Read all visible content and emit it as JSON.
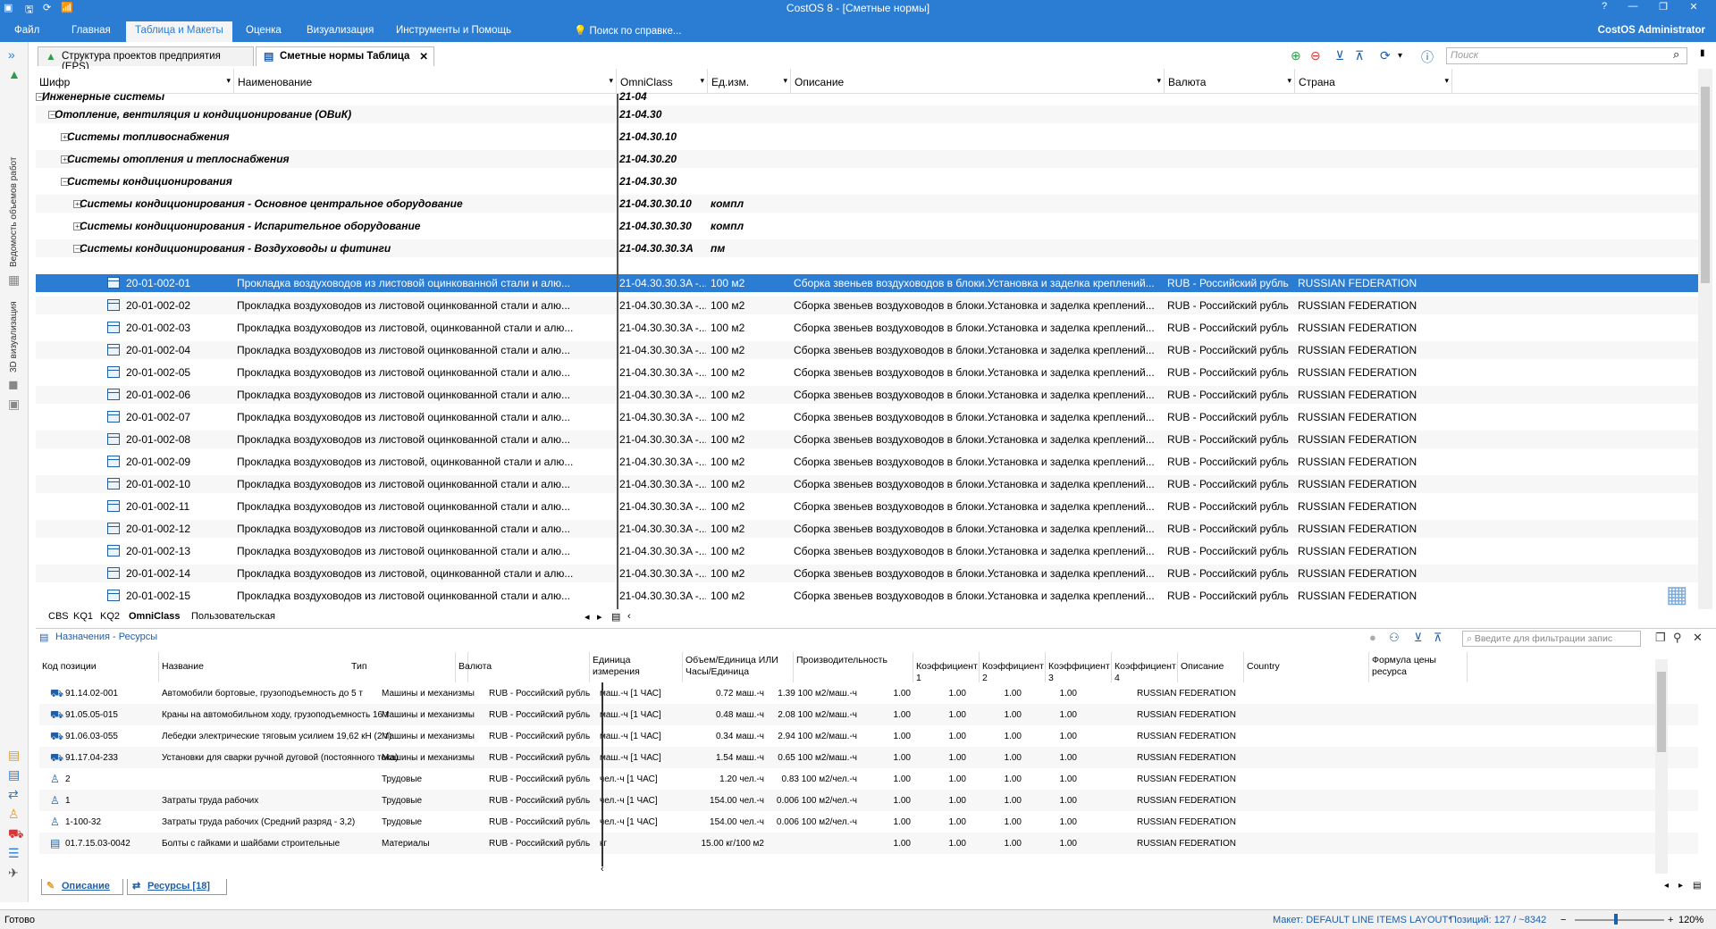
{
  "app": {
    "title": "CostOS 8 - [Сметные нормы]",
    "user": "CostOS Administrator",
    "help_search": "Поиск по справке..."
  },
  "menu": [
    "Файл",
    "Главная",
    "Таблица и Макеты",
    "Оценка",
    "Визуализация",
    "Инструменты и Помощь"
  ],
  "left_vertical": [
    "Ведомость объемов работ",
    "3D визуализация"
  ],
  "doc_tabs": [
    "Структура проектов предприятия (EPS)",
    "Сметные нормы Таблица"
  ],
  "quick_search_placeholder": "Поиск",
  "columns": [
    "Шифр",
    "Наименование",
    "OmniClass",
    "Ед.изм.",
    "Описание",
    "Валюта",
    "Страна"
  ],
  "groups": [
    {
      "name": "Инженерные системы",
      "omni": "21-04",
      "unit": "",
      "exp": "−"
    },
    {
      "name": "Отопление, вентиляция и кондиционирование (ОВиК)",
      "omni": "21-04.30",
      "unit": "",
      "exp": "−"
    },
    {
      "name": "Системы топливоснабжения",
      "omni": "21-04.30.10",
      "unit": "",
      "exp": "+"
    },
    {
      "name": "Системы отопления и теплоснабжения",
      "omni": "21-04.30.20",
      "unit": "",
      "exp": "+"
    },
    {
      "name": "Системы кондиционирования",
      "omni": "21-04.30.30",
      "unit": "",
      "exp": "−"
    },
    {
      "name": "Системы кондиционирования - Основное центральное оборудование",
      "omni": "21-04.30.30.10",
      "unit": "компл",
      "exp": "+"
    },
    {
      "name": "Системы кондиционирования - Испарительное оборудование",
      "omni": "21-04.30.30.30",
      "unit": "компл",
      "exp": "+"
    },
    {
      "name": "Системы кондиционирования - Воздуховоды и фитинги",
      "omni": "21-04.30.30.3A",
      "unit": "пм",
      "exp": "−"
    }
  ],
  "items": [
    {
      "code": "20-01-002-01",
      "name": "Прокладка воздуховодов из листовой оцинкованной стали и алю...",
      "omni": "21-04.30.30.3A -...",
      "unit": "100 м2",
      "desc": "Сборка звеньев воздуховодов в блоки.Установка и заделка креплений...",
      "cur": "RUB - Российский рубль",
      "country": "RUSSIAN FEDERATION"
    },
    {
      "code": "20-01-002-02",
      "name": "Прокладка воздуховодов из листовой оцинкованной стали и алю...",
      "omni": "21-04.30.30.3A -...",
      "unit": "100 м2",
      "desc": "Сборка звеньев воздуховодов в блоки.Установка и заделка креплений...",
      "cur": "RUB - Российский рубль",
      "country": "RUSSIAN FEDERATION"
    },
    {
      "code": "20-01-002-03",
      "name": "Прокладка воздуховодов из листовой, оцинкованной стали и алю...",
      "omni": "21-04.30.30.3A -...",
      "unit": "100 м2",
      "desc": "Сборка звеньев воздуховодов в блоки.Установка и заделка креплений...",
      "cur": "RUB - Российский рубль",
      "country": "RUSSIAN FEDERATION"
    },
    {
      "code": "20-01-002-04",
      "name": "Прокладка воздуховодов из листовой оцинкованной стали и алю...",
      "omni": "21-04.30.30.3A -...",
      "unit": "100 м2",
      "desc": "Сборка звеньев воздуховодов в блоки.Установка и заделка креплений...",
      "cur": "RUB - Российский рубль",
      "country": "RUSSIAN FEDERATION"
    },
    {
      "code": "20-01-002-05",
      "name": "Прокладка воздуховодов из листовой оцинкованной стали и алю...",
      "omni": "21-04.30.30.3A -...",
      "unit": "100 м2",
      "desc": "Сборка звеньев воздуховодов в блоки.Установка и заделка креплений...",
      "cur": "RUB - Российский рубль",
      "country": "RUSSIAN FEDERATION"
    },
    {
      "code": "20-01-002-06",
      "name": "Прокладка воздуховодов из листовой оцинкованной стали и алю...",
      "omni": "21-04.30.30.3A -...",
      "unit": "100 м2",
      "desc": "Сборка звеньев воздуховодов в блоки.Установка и заделка креплений...",
      "cur": "RUB - Российский рубль",
      "country": "RUSSIAN FEDERATION"
    },
    {
      "code": "20-01-002-07",
      "name": "Прокладка воздуховодов из листовой оцинкованной стали и алю...",
      "omni": "21-04.30.30.3A -...",
      "unit": "100 м2",
      "desc": "Сборка звеньев воздуховодов в блоки.Установка и заделка креплений...",
      "cur": "RUB - Российский рубль",
      "country": "RUSSIAN FEDERATION"
    },
    {
      "code": "20-01-002-08",
      "name": "Прокладка воздуховодов из листовой оцинкованной стали и алю...",
      "omni": "21-04.30.30.3A -...",
      "unit": "100 м2",
      "desc": "Сборка звеньев воздуховодов в блоки.Установка и заделка креплений...",
      "cur": "RUB - Российский рубль",
      "country": "RUSSIAN FEDERATION"
    },
    {
      "code": "20-01-002-09",
      "name": "Прокладка воздуховодов из листовой, оцинкованной стали и алю...",
      "omni": "21-04.30.30.3A -...",
      "unit": "100 м2",
      "desc": "Сборка звеньев воздуховодов в блоки.Установка и заделка креплений...",
      "cur": "RUB - Российский рубль",
      "country": "RUSSIAN FEDERATION"
    },
    {
      "code": "20-01-002-10",
      "name": "Прокладка воздуховодов из листовой оцинкованной стали и алю...",
      "omni": "21-04.30.30.3A -...",
      "unit": "100 м2",
      "desc": "Сборка звеньев воздуховодов в блоки.Установка и заделка креплений...",
      "cur": "RUB - Российский рубль",
      "country": "RUSSIAN FEDERATION"
    },
    {
      "code": "20-01-002-11",
      "name": "Прокладка воздуховодов из листовой оцинкованной стали и алю...",
      "omni": "21-04.30.30.3A -...",
      "unit": "100 м2",
      "desc": "Сборка звеньев воздуховодов в блоки.Установка и заделка креплений...",
      "cur": "RUB - Российский рубль",
      "country": "RUSSIAN FEDERATION"
    },
    {
      "code": "20-01-002-12",
      "name": "Прокладка воздуховодов из листовой оцинкованной стали и алю...",
      "omni": "21-04.30.30.3A -...",
      "unit": "100 м2",
      "desc": "Сборка звеньев воздуховодов в блоки.Установка и заделка креплений...",
      "cur": "RUB - Российский рубль",
      "country": "RUSSIAN FEDERATION"
    },
    {
      "code": "20-01-002-13",
      "name": "Прокладка воздуховодов из листовой оцинкованной стали и алю...",
      "omni": "21-04.30.30.3A -...",
      "unit": "100 м2",
      "desc": "Сборка звеньев воздуховодов в блоки.Установка и заделка креплений...",
      "cur": "RUB - Российский рубль",
      "country": "RUSSIAN FEDERATION"
    },
    {
      "code": "20-01-002-14",
      "name": "Прокладка воздуховодов из листовой, оцинкованной стали и алю...",
      "omni": "21-04.30.30.3A -...",
      "unit": "100 м2",
      "desc": "Сборка звеньев воздуховодов в блоки.Установка и заделка креплений...",
      "cur": "RUB - Российский рубль",
      "country": "RUSSIAN FEDERATION"
    },
    {
      "code": "20-01-002-15",
      "name": "Прокладка воздуховодов из листовой оцинкованной стали и алю...",
      "omni": "21-04.30.30.3A -...",
      "unit": "100 м2",
      "desc": "Сборка звеньев воздуховодов в блоки.Установка и заделка креплений...",
      "cur": "RUB - Российский рубль",
      "country": "RUSSIAN FEDERATION"
    }
  ],
  "sheet_tabs": [
    "CBS",
    "KQ1",
    "KQ2",
    "OmniClass",
    "Пользовательская"
  ],
  "panel": {
    "title": "Назначения - Ресурсы",
    "filter_placeholder": "Введите для фильтрации запис"
  },
  "res_columns": [
    "Код позиции",
    "Название",
    "Тип",
    "Валюта",
    "Единица измерения",
    "Объем/Единица ИЛИ Часы/Единица",
    "Производительность",
    "Коэффициент 1",
    "Коэффициент 2",
    "Коэффициент 3",
    "Коэффициент 4",
    "Описание",
    "Country",
    "Формула цены ресурса"
  ],
  "resources": [
    {
      "code": "91.14.02-001",
      "name": "Автомобили бортовые, грузоподъемность до 5 т",
      "type": "Машины и механизмы",
      "cur": "RUB - Российский рубль",
      "unit": "маш.-ч [1 ЧАС]",
      "qty": "0.72 маш.-ч",
      "prod": "1.39 100 м2/маш.-ч",
      "k1": "1.00",
      "k2": "1.00",
      "k3": "1.00",
      "k4": "1.00",
      "country": "RUSSIAN FEDERATION",
      "icon": "⛟"
    },
    {
      "code": "91.05.05-015",
      "name": "Краны на автомобильном ходу, грузоподъемность 16 т",
      "type": "Машины и механизмы",
      "cur": "RUB - Российский рубль",
      "unit": "маш.-ч [1 ЧАС]",
      "qty": "0.48 маш.-ч",
      "prod": "2.08 100 м2/маш.-ч",
      "k1": "1.00",
      "k2": "1.00",
      "k3": "1.00",
      "k4": "1.00",
      "country": "RUSSIAN FEDERATION",
      "icon": "⛟"
    },
    {
      "code": "91.06.03-055",
      "name": "Лебедки электрические тяговым усилием 19,62 кН (2 т)",
      "type": "Машины и механизмы",
      "cur": "RUB - Российский рубль",
      "unit": "маш.-ч [1 ЧАС]",
      "qty": "0.34 маш.-ч",
      "prod": "2.94 100 м2/маш.-ч",
      "k1": "1.00",
      "k2": "1.00",
      "k3": "1.00",
      "k4": "1.00",
      "country": "RUSSIAN FEDERATION",
      "icon": "⛟"
    },
    {
      "code": "91.17.04-233",
      "name": "Установки для сварки ручной дуговой (постоянного тока)",
      "type": "Машины и механизмы",
      "cur": "RUB - Российский рубль",
      "unit": "маш.-ч [1 ЧАС]",
      "qty": "1.54 маш.-ч",
      "prod": "0.65 100 м2/маш.-ч",
      "k1": "1.00",
      "k2": "1.00",
      "k3": "1.00",
      "k4": "1.00",
      "country": "RUSSIAN FEDERATION",
      "icon": "⛟"
    },
    {
      "code": "2",
      "name": "",
      "type": "Трудовые",
      "cur": "RUB - Российский рубль",
      "unit": "чел.-ч [1 ЧАС]",
      "qty": "1.20 чел.-ч",
      "prod": "0.83 100 м2/чел.-ч",
      "k1": "1.00",
      "k2": "1.00",
      "k3": "1.00",
      "k4": "1.00",
      "country": "RUSSIAN FEDERATION",
      "icon": "♙"
    },
    {
      "code": "1",
      "name": "Затраты труда рабочих",
      "type": "Трудовые",
      "cur": "RUB - Российский рубль",
      "unit": "чел.-ч [1 ЧАС]",
      "qty": "154.00 чел.-ч",
      "prod": "0.006 100 м2/чел.-ч",
      "k1": "1.00",
      "k2": "1.00",
      "k3": "1.00",
      "k4": "1.00",
      "country": "RUSSIAN FEDERATION",
      "icon": "♙"
    },
    {
      "code": "1-100-32",
      "name": "Затраты труда рабочих (Средний разряд - 3,2)",
      "type": "Трудовые",
      "cur": "RUB - Российский рубль",
      "unit": "чел.-ч [1 ЧАС]",
      "qty": "154.00 чел.-ч",
      "prod": "0.006 100 м2/чел.-ч",
      "k1": "1.00",
      "k2": "1.00",
      "k3": "1.00",
      "k4": "1.00",
      "country": "RUSSIAN FEDERATION",
      "icon": "♙"
    },
    {
      "code": "01.7.15.03-0042",
      "name": "Болты с гайками и шайбами строительные",
      "type": "Материалы",
      "cur": "RUB - Российский рубль",
      "unit": "кг",
      "qty": "15.00 кг/100 м2",
      "prod": "",
      "k1": "1.00",
      "k2": "1.00",
      "k3": "1.00",
      "k4": "1.00",
      "country": "RUSSIAN FEDERATION",
      "icon": "▤"
    }
  ],
  "panel_tabs": [
    "Описание",
    "Ресурсы [18]"
  ],
  "status": {
    "left": "Готово",
    "layout": "Макет: DEFAULT LINE ITEMS LAYOUT*",
    "position": "Позиций: 127 / ~8342",
    "zoom": "120%"
  }
}
